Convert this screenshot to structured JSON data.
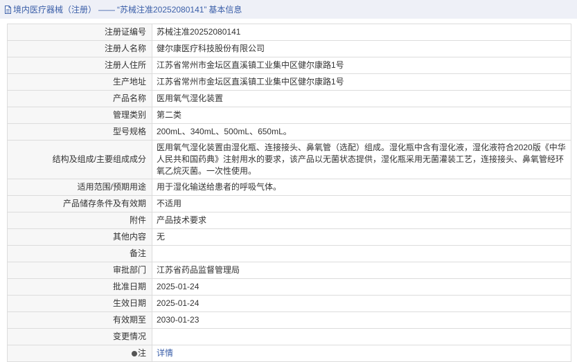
{
  "header": {
    "category": "境内医疗器械（注册）",
    "separator": "——",
    "registration_quote": "“苏械注准20252080141”",
    "section": "基本信息"
  },
  "rows": [
    {
      "label": "注册证编号",
      "value": "苏械注准20252080141"
    },
    {
      "label": "注册人名称",
      "value": "健尔康医疗科技股份有限公司"
    },
    {
      "label": "注册人住所",
      "value": "江苏省常州市金坛区直溪镇工业集中区健尔康路1号"
    },
    {
      "label": "生产地址",
      "value": "江苏省常州市金坛区直溪镇工业集中区健尔康路1号"
    },
    {
      "label": "产品名称",
      "value": "医用氧气湿化装置"
    },
    {
      "label": "管理类别",
      "value": "第二类"
    },
    {
      "label": "型号规格",
      "value": "200mL、340mL、500mL、650mL。"
    },
    {
      "label": "结构及组成/主要组成成分",
      "value": "医用氧气湿化装置由湿化瓶、连接接头、鼻氧管（选配）组成。湿化瓶中含有湿化液，湿化液符合2020版《中华人民共和国药典》注射用水的要求，该产品以无菌状态提供，湿化瓶采用无菌灌装工艺，连接接头、鼻氧管经环氧乙烷灭菌。一次性使用。"
    },
    {
      "label": "适用范围/预期用途",
      "value": "用于湿化输送给患者的呼吸气体。"
    },
    {
      "label": "产品储存条件及有效期",
      "value": "不适用"
    },
    {
      "label": "附件",
      "value": "产品技术要求"
    },
    {
      "label": "其他内容",
      "value": "无"
    },
    {
      "label": "备注",
      "value": ""
    },
    {
      "label": "审批部门",
      "value": "江苏省药品监督管理局"
    },
    {
      "label": "批准日期",
      "value": "2025-01-24"
    },
    {
      "label": "生效日期",
      "value": "2025-01-24"
    },
    {
      "label": "有效期至",
      "value": "2030-01-23"
    },
    {
      "label": "变更情况",
      "value": ""
    }
  ],
  "note_row": {
    "label": "注",
    "link": "详情"
  }
}
